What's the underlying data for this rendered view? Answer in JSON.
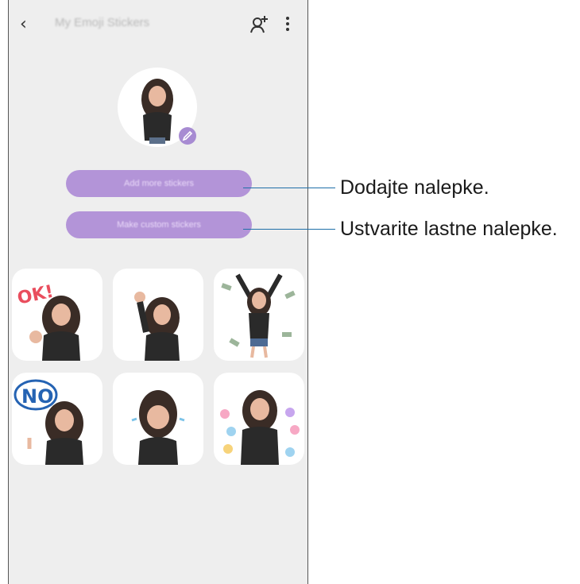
{
  "header": {
    "title": "My Emoji Stickers",
    "back_icon": "chevron-left-icon",
    "add_avatar_icon": "add-avatar-icon",
    "more_icon": "more-vertical-icon"
  },
  "buttons": {
    "add_more": "Add more stickers",
    "make_custom": "Make custom stickers"
  },
  "stickers": [
    {
      "name": "sticker-ok",
      "caption": "OK!"
    },
    {
      "name": "sticker-wave",
      "caption": ""
    },
    {
      "name": "sticker-money",
      "caption": ""
    },
    {
      "name": "sticker-no",
      "caption": "NO"
    },
    {
      "name": "sticker-cry",
      "caption": ""
    },
    {
      "name": "sticker-hearts",
      "caption": ""
    }
  ],
  "callouts": {
    "add_more": "Dodajte nalepke.",
    "make_custom": "Ustvarite lastne nalepke."
  },
  "colors": {
    "button_purple": "#b394d8",
    "callout_line": "#1f6fa8",
    "screen_bg": "#eeeeee"
  }
}
